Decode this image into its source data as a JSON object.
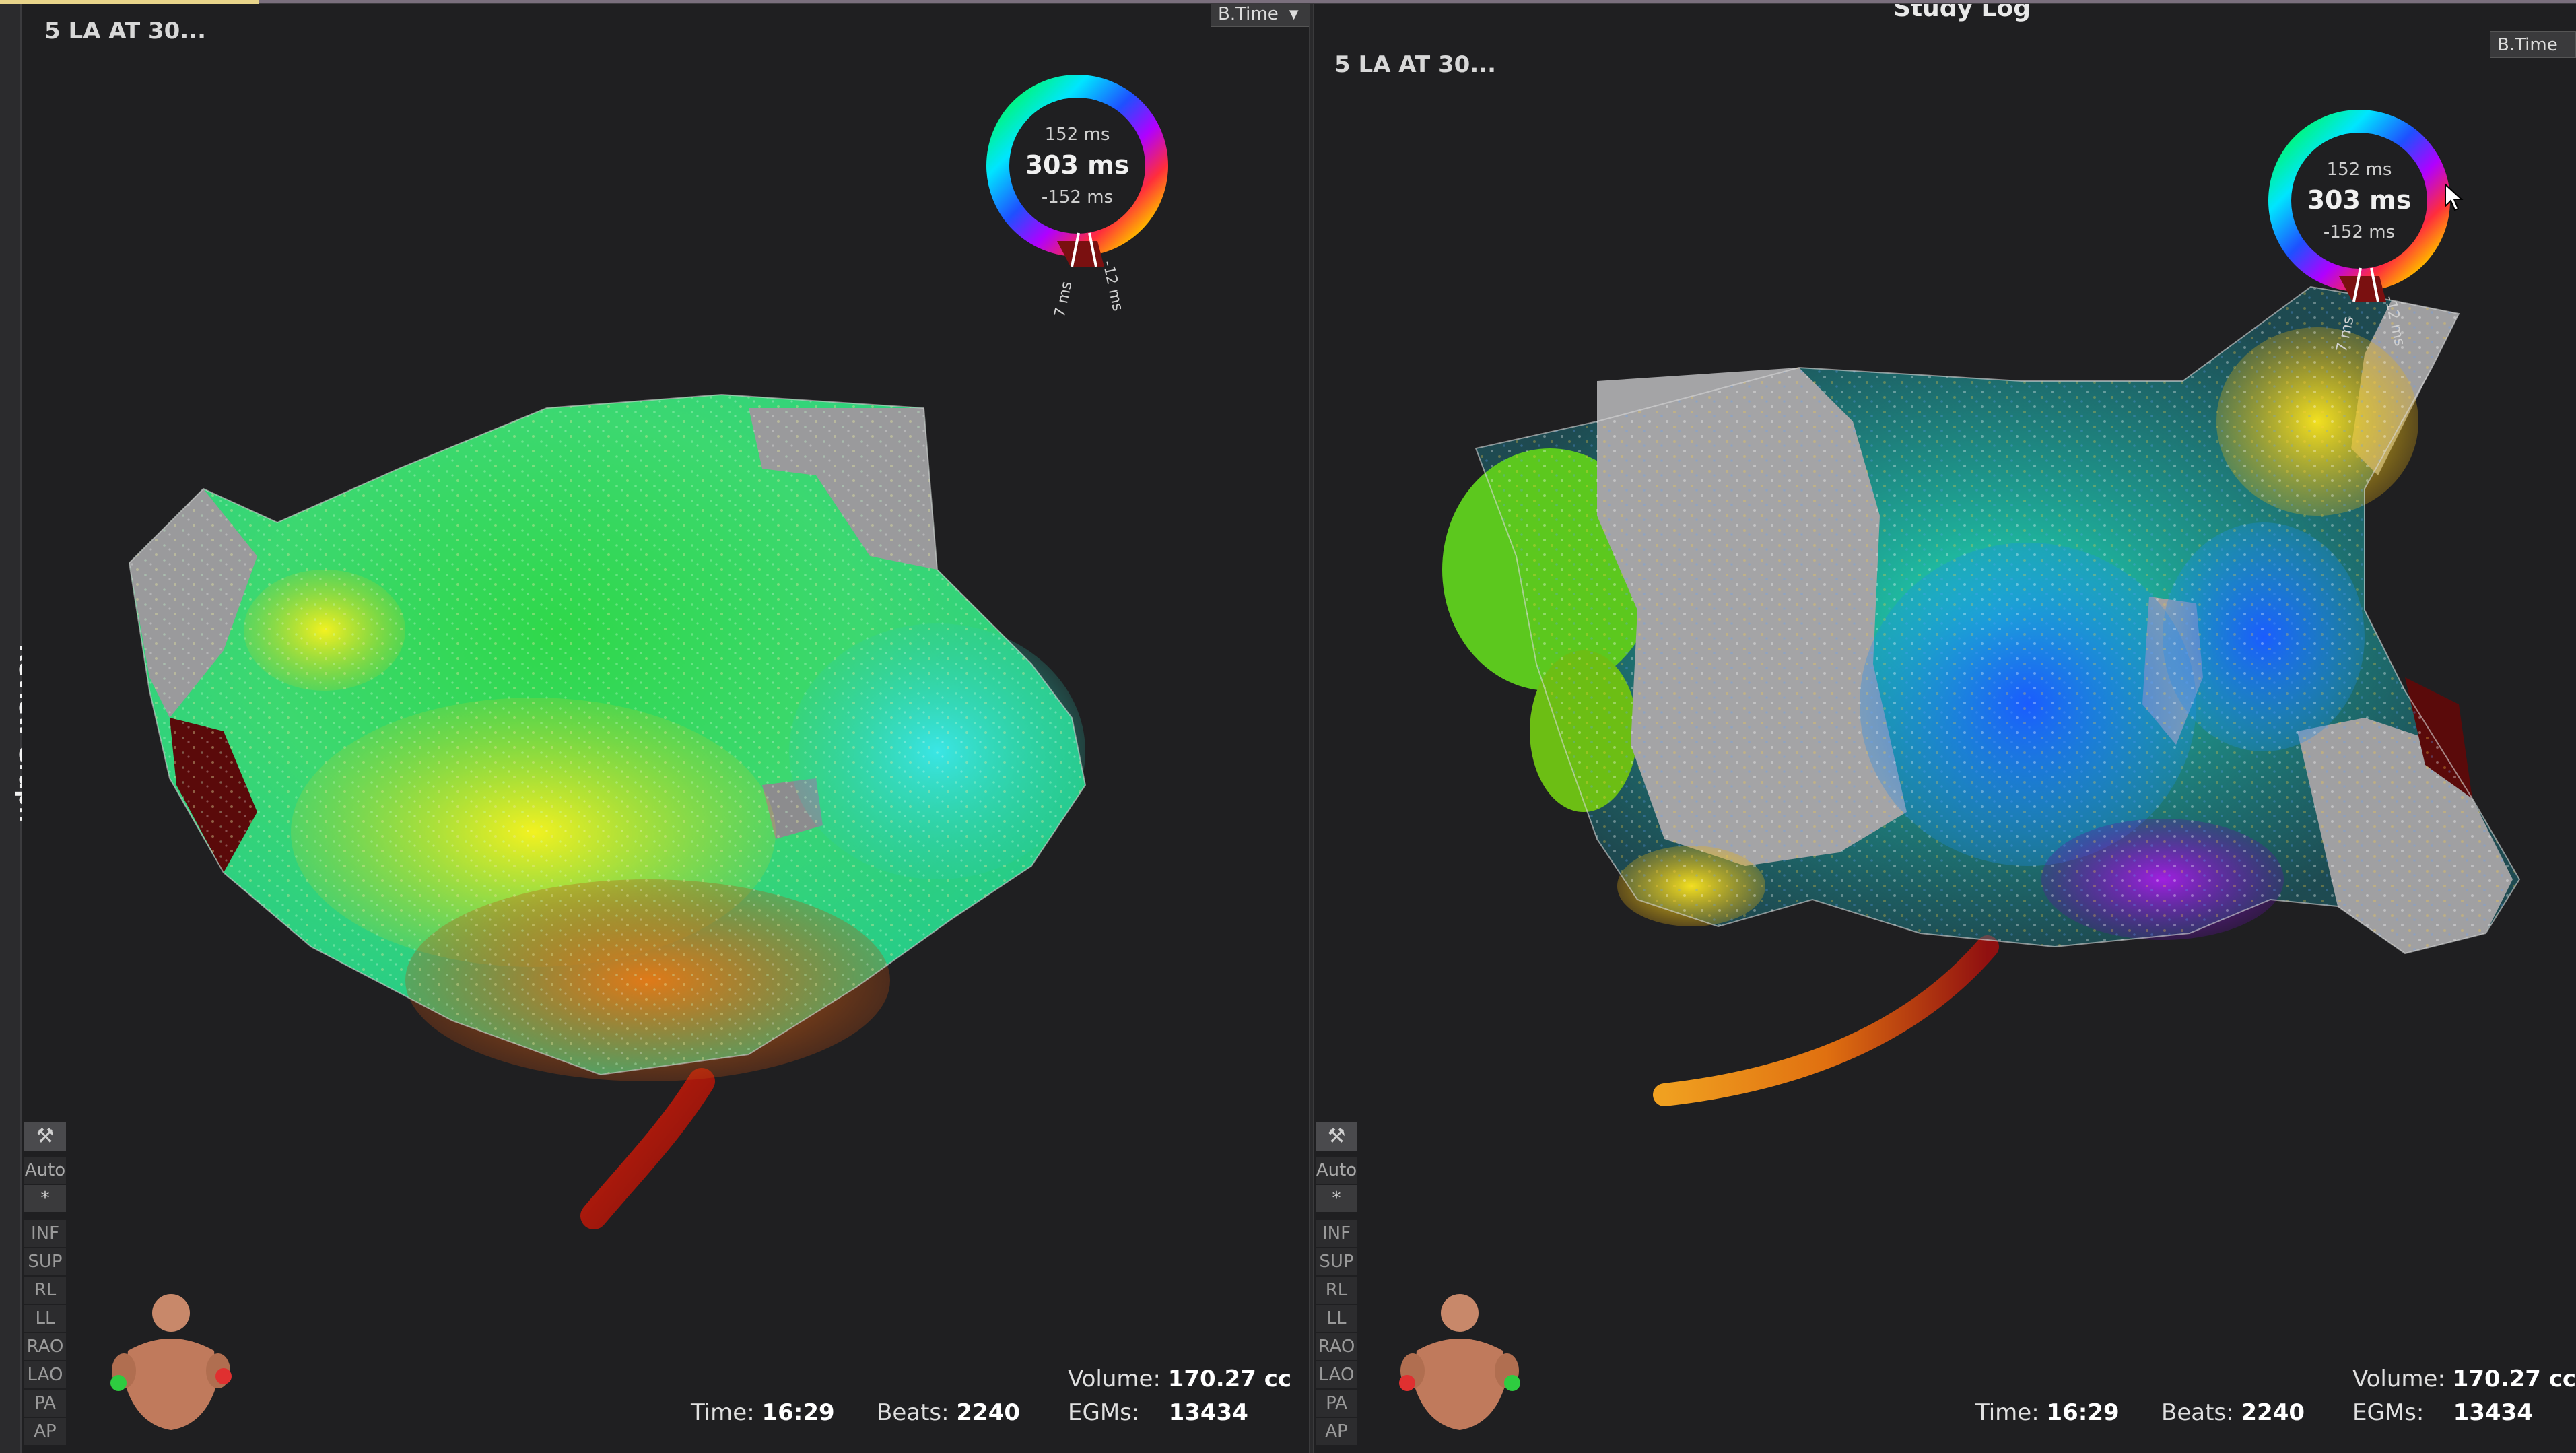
{
  "left_panel": {
    "map_title": "5 LA AT 30...",
    "dropdown_label": "B.Time",
    "ring": {
      "top": "152 ms",
      "center": "303 ms",
      "bottom": "-152 ms",
      "tick_left": "7 ms",
      "tick_right": "-12 ms"
    },
    "stats": {
      "volume_label": "Volume:",
      "volume_value": "170.27 cc",
      "time_label": "Time:",
      "time_value": "16:29",
      "beats_label": "Beats:",
      "beats_value": "2240",
      "egms_label": "EGMs:",
      "egms_value": "13434"
    },
    "view_buttons": [
      "INF",
      "SUP",
      "RL",
      "LL",
      "RAO",
      "LAO",
      "PA",
      "AP"
    ],
    "auto_label": "Auto",
    "star_label": "*"
  },
  "right_panel": {
    "map_title": "5 LA AT 30...",
    "panel_header": "Study Log",
    "dropdown_label": "B.Time",
    "ring": {
      "top": "152 ms",
      "center": "303 ms",
      "bottom": "-152 ms",
      "tick_left": "7 ms",
      "tick_right": "-12 ms"
    },
    "stats": {
      "volume_label": "Volume:",
      "volume_value": "170.27 cc",
      "time_label": "Time:",
      "time_value": "16:29",
      "beats_label": "Beats:",
      "beats_value": "2240",
      "egms_label": "EGMs:",
      "egms_value": "13434"
    },
    "view_buttons": [
      "INF",
      "SUP",
      "RL",
      "LL",
      "RAO",
      "LAO",
      "PA",
      "AP"
    ],
    "auto_label": "Auto",
    "star_label": "*"
  },
  "sidebar": {
    "label": "Review Graph"
  },
  "colors": {
    "background": "#1f1f21",
    "ring_gradient": [
      "#00ff3c",
      "#00e5ff",
      "#1e50ff",
      "#b000ff",
      "#ff2d3c",
      "#ffb000",
      "#ffff00"
    ],
    "button_bg": "#2c2c2e",
    "text": "#e0e0e0"
  },
  "icons": {
    "tool": "wrench-icon",
    "body": "torso-orientation-icon",
    "cursor": "mouse-cursor-icon"
  }
}
